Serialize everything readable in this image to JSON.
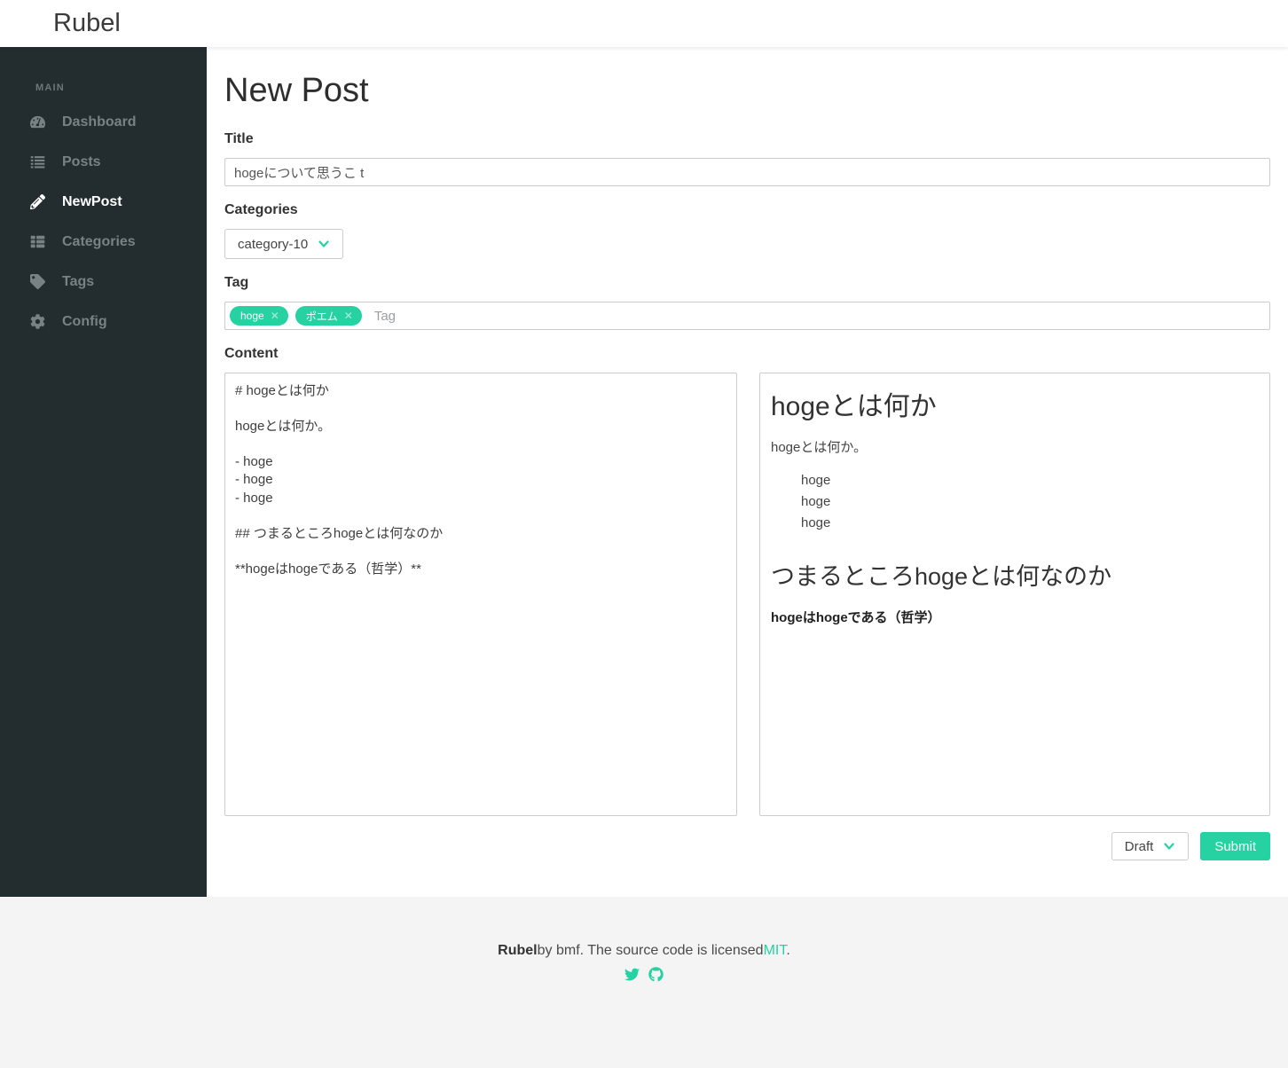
{
  "topbar": {
    "logo": "Rubel"
  },
  "sidebar": {
    "section_label": "MAIN",
    "items": [
      {
        "label": "Dashboard",
        "icon": "tachometer-icon",
        "active": false
      },
      {
        "label": "Posts",
        "icon": "list-icon",
        "active": false
      },
      {
        "label": "NewPost",
        "icon": "pencil-icon",
        "active": true
      },
      {
        "label": "Categories",
        "icon": "th-list-icon",
        "active": false
      },
      {
        "label": "Tags",
        "icon": "tags-icon",
        "active": false
      },
      {
        "label": "Config",
        "icon": "gear-icon",
        "active": false
      }
    ]
  },
  "main": {
    "page_title": "New Post",
    "title_field": {
      "label": "Title",
      "value": "hogeについて思うこ t"
    },
    "categories_field": {
      "label": "Categories",
      "selected": "category-10"
    },
    "tag_field": {
      "label": "Tag",
      "tags": [
        "hoge",
        "ポエム"
      ],
      "placeholder": "Tag"
    },
    "content_field": {
      "label": "Content",
      "markdown": "# hogeとは何か\n\nhogeとは何か。\n\n- hoge\n- hoge\n- hoge\n\n## つまるところhogeとは何なのか\n\n**hogeはhogeである（哲学）**",
      "preview": {
        "h1": "hogeとは何か",
        "p1": "hogeとは何か。",
        "list": [
          "hoge",
          "hoge",
          "hoge"
        ],
        "h2": "つまるところhogeとは何なのか",
        "bold": "hogeはhogeである（哲学）"
      }
    },
    "status_select": {
      "value": "Draft"
    },
    "submit_label": "Submit"
  },
  "footer": {
    "brand": "Rubel",
    "text": "by bmf. The source code is licensed",
    "license_link": "MIT",
    "period": ".",
    "icons": [
      "twitter-icon",
      "github-icon"
    ]
  },
  "colors": {
    "accent": "#26d1a2",
    "sidebar_bg": "#232d2f",
    "footer_bg": "#f4f4f5"
  }
}
